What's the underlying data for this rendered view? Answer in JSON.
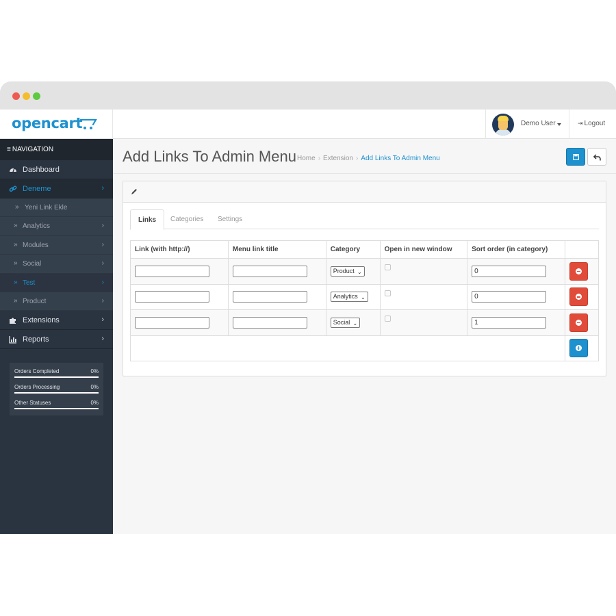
{
  "header": {
    "logo": "opencart",
    "user_name": "Demo User",
    "logout_label": "Logout"
  },
  "sidebar": {
    "heading": "NAVIGATION",
    "items": [
      {
        "label": "Dashboard",
        "icon": "dashboard-icon"
      },
      {
        "label": "Deneme",
        "icon": "link-icon",
        "active": true
      },
      {
        "label": "Extensions",
        "icon": "puzzle-icon"
      },
      {
        "label": "Reports",
        "icon": "bar-chart-icon"
      }
    ],
    "subitems": [
      {
        "label": "Yeni Link Ekle"
      },
      {
        "label": "Analytics"
      },
      {
        "label": "Modules"
      },
      {
        "label": "Social"
      },
      {
        "label": "Test",
        "active": true
      },
      {
        "label": "Product"
      }
    ],
    "stats": [
      {
        "label": "Orders Completed",
        "value": "0%"
      },
      {
        "label": "Orders Processing",
        "value": "0%"
      },
      {
        "label": "Other Statuses",
        "value": "0%"
      }
    ]
  },
  "page": {
    "title": "Add Links To Admin Menu",
    "breadcrumb": [
      "Home",
      "Extension",
      "Add Links To Admin Menu"
    ]
  },
  "tabs": [
    "Links",
    "Categories",
    "Settings"
  ],
  "table": {
    "headers": [
      "Link (with http://)",
      "Menu link title",
      "Category",
      "Open in new window",
      "Sort order (in category)"
    ],
    "rows": [
      {
        "link": "",
        "title": "",
        "category": "Product",
        "sort": "0"
      },
      {
        "link": "",
        "title": "",
        "category": "Analytics",
        "sort": "0"
      },
      {
        "link": "",
        "title": "",
        "category": "Social",
        "sort": "1"
      }
    ]
  },
  "colors": {
    "accent": "#1e91cf",
    "danger": "#e04b3a",
    "sidebar": "#2a3340"
  }
}
